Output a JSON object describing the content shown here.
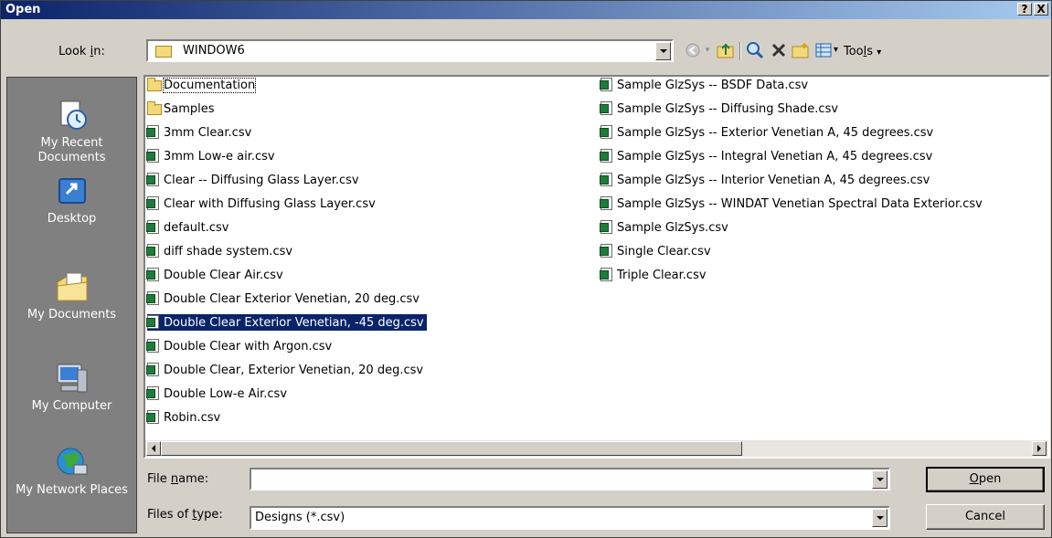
{
  "window": {
    "title": "Open",
    "help_label": "?",
    "close_label": "X"
  },
  "look_in": {
    "label_pre": "Look ",
    "label_key": "i",
    "label_post": "n:",
    "value": "WINDOW6"
  },
  "toolbar": {
    "tools_pre": "Too",
    "tools_key": "l",
    "tools_post": "s",
    "menu_arrow": "▾"
  },
  "places": [
    {
      "label": "My Recent Documents",
      "icon": "recent-documents-icon"
    },
    {
      "label": "Desktop",
      "icon": "desktop-icon"
    },
    {
      "label": "My Documents",
      "icon": "my-documents-icon"
    },
    {
      "label": "My Computer",
      "icon": "my-computer-icon"
    },
    {
      "label": "My Network Places",
      "icon": "network-places-icon"
    }
  ],
  "files_col1": [
    {
      "name": "Documentation",
      "type": "folder"
    },
    {
      "name": "Samples",
      "type": "folder"
    },
    {
      "name": "3mm Clear.csv",
      "type": "csv"
    },
    {
      "name": "3mm Low-e air.csv",
      "type": "csv"
    },
    {
      "name": "Clear -- Diffusing Glass Layer.csv",
      "type": "csv"
    },
    {
      "name": "Clear with Diffusing Glass Layer.csv",
      "type": "csv"
    },
    {
      "name": "default.csv",
      "type": "csv"
    },
    {
      "name": "diff shade system.csv",
      "type": "csv"
    },
    {
      "name": "Double Clear Air.csv",
      "type": "csv"
    },
    {
      "name": "Double Clear Exterior Venetian, 20 deg.csv",
      "type": "csv"
    },
    {
      "name": "Double Clear Exterior Venetian, -45 deg.csv",
      "type": "csv"
    },
    {
      "name": "Double Clear with Argon.csv",
      "type": "csv"
    },
    {
      "name": "Double Clear, Exterior Venetian, 20 deg.csv",
      "type": "csv"
    },
    {
      "name": "Double Low-e Air.csv",
      "type": "csv"
    },
    {
      "name": "Robin.csv",
      "type": "csv"
    }
  ],
  "files_col2": [
    {
      "name": "Sample GlzSys -- BSDF Data.csv",
      "type": "csv"
    },
    {
      "name": "Sample GlzSys -- Diffusing Shade.csv",
      "type": "csv"
    },
    {
      "name": "Sample GlzSys -- Exterior Venetian A, 45 degrees.csv",
      "type": "csv"
    },
    {
      "name": "Sample GlzSys -- Integral Venetian A, 45 degrees.csv",
      "type": "csv"
    },
    {
      "name": "Sample GlzSys -- Interior Venetian A, 45 degrees.csv",
      "type": "csv"
    },
    {
      "name": "Sample GlzSys -- WINDAT Venetian Spectral Data Exterior.csv",
      "type": "csv"
    },
    {
      "name": "Sample GlzSys.csv",
      "type": "csv"
    },
    {
      "name": "Single Clear.csv",
      "type": "csv"
    },
    {
      "name": "Triple Clear.csv",
      "type": "csv"
    }
  ],
  "selected_file": "Double Clear Exterior Venetian, -45 deg.csv",
  "file_name": {
    "label_pre": "File ",
    "label_key": "n",
    "label_post": "ame:",
    "value": ""
  },
  "file_type": {
    "label_pre": "Files of ",
    "label_key": "t",
    "label_post": "ype:",
    "value": "Designs (*.csv)"
  },
  "buttons": {
    "open_key": "O",
    "open_rest": "pen",
    "cancel": "Cancel"
  },
  "colors": {
    "selection": "#0a246a",
    "face": "#d4d0c8",
    "title_start": "#0a246a",
    "title_end": "#a6caf0"
  }
}
